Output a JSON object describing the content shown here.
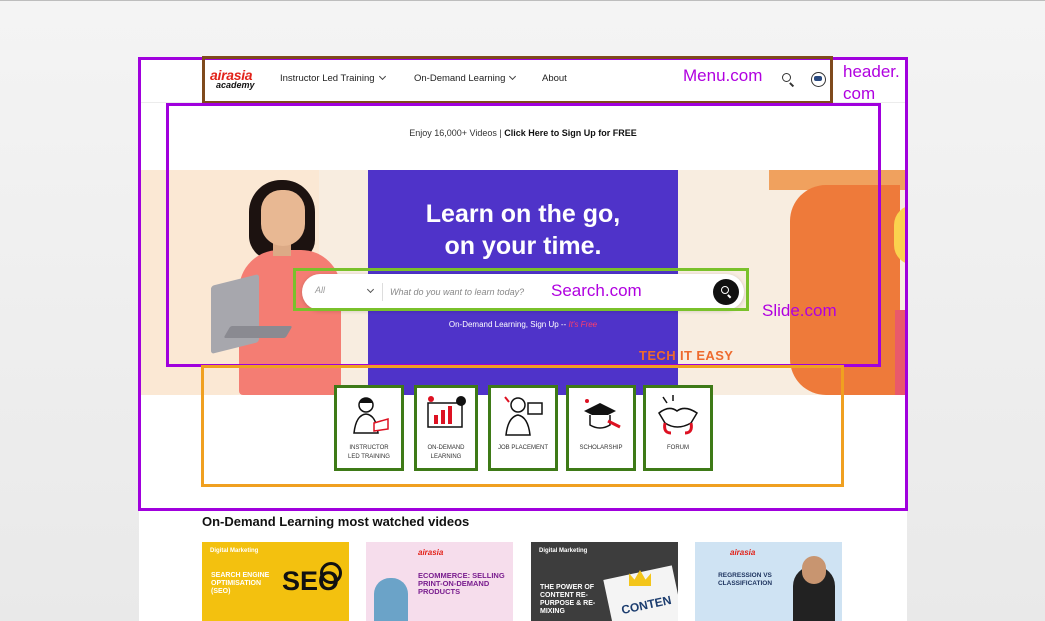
{
  "header": {
    "logo_line1": "airasia",
    "logo_line2": "academy",
    "nav": [
      {
        "label": "Instructor Led Training"
      },
      {
        "label": "On-Demand Learning"
      },
      {
        "label": "About"
      }
    ]
  },
  "promo": {
    "text": "Enjoy 16,000+ Videos | ",
    "cta": "Click Here to Sign Up for FREE"
  },
  "hero": {
    "title_line1": "Learn on the go,",
    "title_line2": "on your time.",
    "search": {
      "category": "All",
      "placeholder": "What do you want to learn today?"
    },
    "subtext": "On-Demand Learning, Sign Up -- ",
    "subtext_free": "It's Free",
    "tagline": "TECH IT EASY"
  },
  "categories": [
    {
      "label_line1": "Instructor",
      "label_line2": "Led Training"
    },
    {
      "label_line1": "On-Demand",
      "label_line2": "Learning"
    },
    {
      "label_line1": "Job Placement",
      "label_line2": ""
    },
    {
      "label_line1": "Scholarship",
      "label_line2": ""
    },
    {
      "label_line1": "Forum",
      "label_line2": ""
    }
  ],
  "videos": {
    "title": "On-Demand Learning most watched videos",
    "items": [
      {
        "tag": "Digital Marketing",
        "title": "Search Engine Optimisation (SEO)",
        "art": "SEO"
      },
      {
        "logo": "airasia",
        "title": "Ecommerce: Selling Print-On-Demand Products"
      },
      {
        "tag": "Digital Marketing",
        "title": "The Power of Content Re-Purpose & Re-Mixing",
        "art": "CONTEN"
      },
      {
        "logo": "airasia",
        "title": "Regression vs Classification"
      }
    ]
  },
  "annotations": {
    "menu": "Menu.com",
    "header_line1": "header.",
    "header_line2": "com",
    "search": "Search.com",
    "slide": "Slide.com"
  },
  "colors": {
    "brand_red": "#e2231a",
    "hero_purple": "#4f33c9",
    "annotation_purple": "#a000dd",
    "annotation_brown": "#7f4a1c",
    "annotation_green": "#7ac12b",
    "annotation_orange": "#f0a020",
    "category_border": "#3e7a17"
  }
}
